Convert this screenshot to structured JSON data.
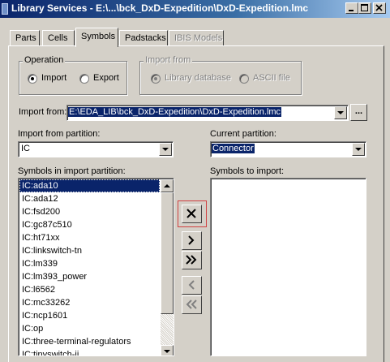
{
  "window": {
    "title": "Library Services - E:\\...\\bck_DxD-Expedition\\DxD-Expedition.lmc"
  },
  "tabs": [
    {
      "label": "Parts",
      "state": "normal"
    },
    {
      "label": "Cells",
      "state": "normal"
    },
    {
      "label": "Symbols",
      "state": "active"
    },
    {
      "label": "Padstacks",
      "state": "normal"
    },
    {
      "label": "IBIS Models",
      "state": "disabled"
    }
  ],
  "operation": {
    "label": "Operation",
    "import_label": "Import",
    "export_label": "Export",
    "selected": "Import"
  },
  "import_from_group": {
    "label": "Import from",
    "library_database_label": "Library database",
    "ascii_file_label": "ASCII file",
    "selected": "Library database"
  },
  "import_from": {
    "label": "Import from:",
    "value": "E:\\EDA_LIB\\bck_DxD-Expedition\\DxD-Expedition.lmc",
    "browse_label": "..."
  },
  "import_partition": {
    "label": "Import from partition:",
    "value": "IC"
  },
  "current_partition": {
    "label": "Current partition:",
    "value": "Connector"
  },
  "symbols_in_import": {
    "label": "Symbols in import partition:",
    "items": [
      "IC:ada10",
      "IC:ada12",
      "IC:fsd200",
      "IC:gc87c510",
      "IC:ht71xx",
      "IC:linkswitch-tn",
      "IC:lm339",
      "IC:lm393_power",
      "IC:l6562",
      "IC:mc33262",
      "IC:ncp1601",
      "IC:op",
      "IC:three-terminal-regulators",
      "IC:tinyswitch-ii"
    ],
    "selected_index": 0
  },
  "symbols_to_import": {
    "label": "Symbols to import:",
    "items": []
  },
  "transfer_buttons": {
    "delete_icon": "x-icon",
    "add_icon": "chevron-right-icon",
    "add_all_icon": "double-chevron-right-icon",
    "remove_icon": "chevron-left-icon",
    "remove_all_icon": "double-chevron-left-icon",
    "highlight_color": "#d04040"
  },
  "colors": {
    "titlebar": "#0a246a",
    "selection": "#0a246a",
    "face": "#d4d0c8"
  }
}
